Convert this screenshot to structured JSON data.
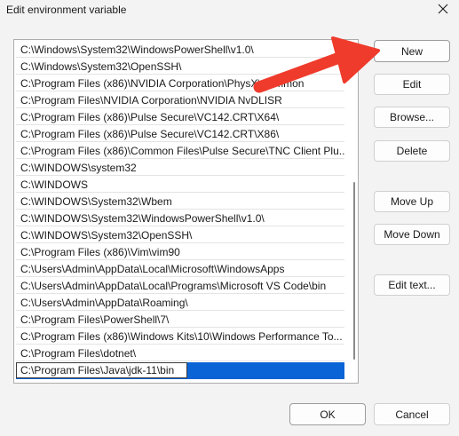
{
  "window": {
    "title": "Edit environment variable"
  },
  "icons": {
    "close": "close-icon",
    "annotation": "red-arrow-icon"
  },
  "colors": {
    "selection": "#0a64d6",
    "annotation_arrow": "#ef3b2c"
  },
  "paths": {
    "items": [
      "C:\\Windows\\System32\\WindowsPowerShell\\v1.0\\",
      "C:\\Windows\\System32\\OpenSSH\\",
      "C:\\Program Files (x86)\\NVIDIA Corporation\\PhysX\\Common",
      "C:\\Program Files\\NVIDIA Corporation\\NVIDIA NvDLISR",
      "C:\\Program Files (x86)\\Pulse Secure\\VC142.CRT\\X64\\",
      "C:\\Program Files (x86)\\Pulse Secure\\VC142.CRT\\X86\\",
      "C:\\Program Files (x86)\\Common Files\\Pulse Secure\\TNC Client Plu...",
      "C:\\WINDOWS\\system32",
      "C:\\WINDOWS",
      "C:\\WINDOWS\\System32\\Wbem",
      "C:\\WINDOWS\\System32\\WindowsPowerShell\\v1.0\\",
      "C:\\WINDOWS\\System32\\OpenSSH\\",
      "C:\\Program Files (x86)\\Vim\\vim90",
      "C:\\Users\\Admin\\AppData\\Local\\Microsoft\\WindowsApps",
      "C:\\Users\\Admin\\AppData\\Local\\Programs\\Microsoft VS Code\\bin",
      "C:\\Users\\Admin\\AppData\\Roaming\\",
      "C:\\Program Files\\PowerShell\\7\\",
      "C:\\Program Files (x86)\\Windows Kits\\10\\Windows Performance To...",
      "C:\\Program Files\\dotnet\\"
    ],
    "editing_value": "C:\\Program Files\\Java\\jdk-11\\bin"
  },
  "buttons": {
    "new": "New",
    "edit": "Edit",
    "browse": "Browse...",
    "delete": "Delete",
    "move_up": "Move Up",
    "move_down": "Move Down",
    "edit_text": "Edit text...",
    "ok": "OK",
    "cancel": "Cancel"
  }
}
